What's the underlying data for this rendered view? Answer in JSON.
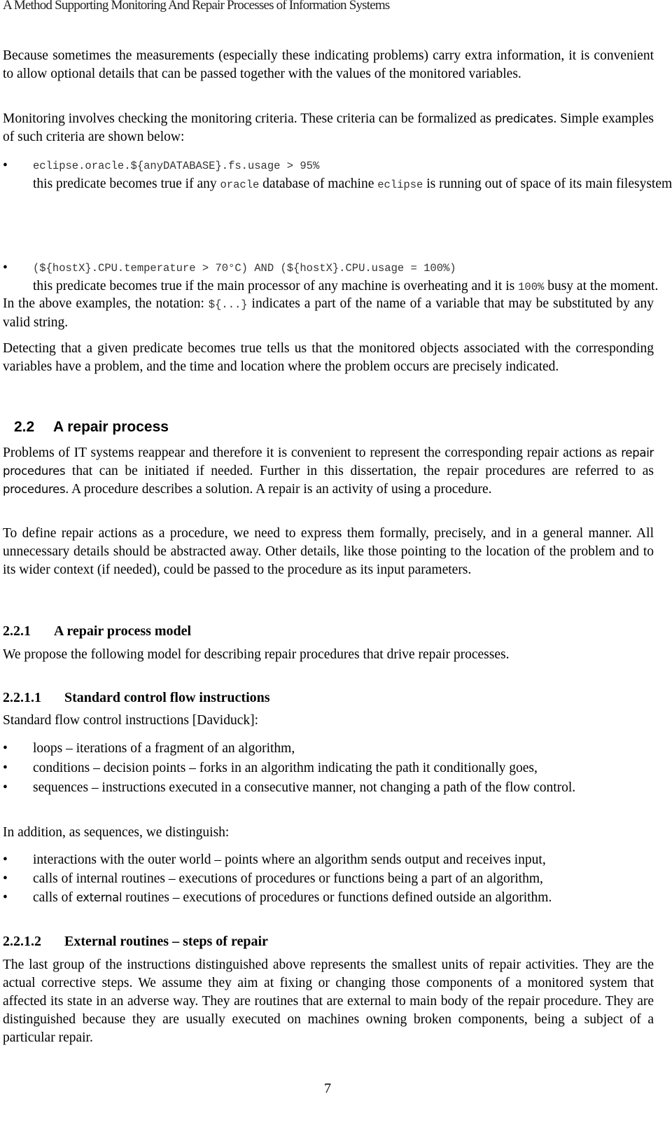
{
  "running_header": "A Method Supporting Monitoring And Repair Processes of Information Systems",
  "p1": "Because sometimes the measurements (especially these indicating problems) carry extra information, it is convenient to allow optional details that can be passed together with the values of the monitored variables.",
  "p2": {
    "a": "Monitoring involves checking the monitoring criteria. These criteria can be formalized as ",
    "term": "predicates",
    "b": ". Simple examples of such criteria are shown below:"
  },
  "examples": [
    {
      "code": "eclipse.oracle.${anyDATABASE}.fs.usage > 95%",
      "t1": "this predicate becomes true if any ",
      "c1": "oracle",
      "t2": " database of machine ",
      "c2": "eclipse",
      "t3": " is running out of space of its main filesystem,"
    },
    {
      "code": "(${hostX}.CPU.temperature > 70°C) AND (${hostX}.CPU.usage = 100%)",
      "t1": "this predicate becomes true if the main processor of any machine is overheating and it is ",
      "c1": "100%",
      "t2": " busy at the moment."
    }
  ],
  "p3": {
    "a": "In the above examples, the notation: ",
    "code": "${...}",
    "b": " indicates a part of the name of a variable that may be substituted by any valid string."
  },
  "p4": "Detecting that a given predicate becomes true tells us that the monitored objects associated with the corresponding variables have a problem, and the time and location where the problem occurs are precisely indicated.",
  "s22": {
    "num": "2.2",
    "title": "A repair process"
  },
  "p5": {
    "a": "Problems of IT systems reappear and therefore it is convenient to represent the corresponding repair actions as ",
    "term1": "repair procedures",
    "b": " that can be initiated if needed. Further in this dissertation, the repair procedures are referred to as ",
    "term2": "procedures",
    "c": ". A procedure describes a solution. A repair is an activity of using a procedure."
  },
  "p6": "To define repair actions as a procedure, we need to express them formally, precisely, and in a general manner. All unnecessary details should be abstracted away. Other details, like those pointing to the location of the problem and to its wider context (if needed), could be passed to the procedure as its input parameters.",
  "s221": {
    "num": "2.2.1",
    "title": "A repair process model"
  },
  "p7": "We propose the following model for describing repair procedures that drive repair processes.",
  "s2211": {
    "num": "2.2.1.1",
    "title": "Standard control flow instructions"
  },
  "p8": "Standard flow control instructions [Daviduck]:",
  "list1": [
    "loops – iterations of a fragment of an algorithm,",
    "conditions – decision points – forks in an algorithm indicating the path it conditionally goes,",
    "sequences – instructions executed in a consecutive manner, not changing a path of the flow control."
  ],
  "p9": "In addition, as sequences, we distinguish:",
  "list2": [
    {
      "a": "interactions with the outer world – points where an algorithm sends output and receives input,"
    },
    {
      "a": "calls of internal routines – executions of procedures or functions being a part of an algorithm,"
    },
    {
      "a": "calls of ",
      "term": "external",
      "b": " routines – executions of procedures or functions defined outside an algorithm."
    }
  ],
  "s2212": {
    "num": "2.2.1.2",
    "title": "External routines – steps of repair"
  },
  "p10": "The last group of the instructions distinguished above represents the smallest units of repair activities. They are the actual corrective steps. We assume they aim at fixing or changing those components of a monitored system that affected its state in an adverse way. They are routines that are external to main body of the repair procedure. They are distinguished because they are usually executed on machines owning broken components, being a subject of a particular repair.",
  "page_number": "7",
  "bullet": "•"
}
